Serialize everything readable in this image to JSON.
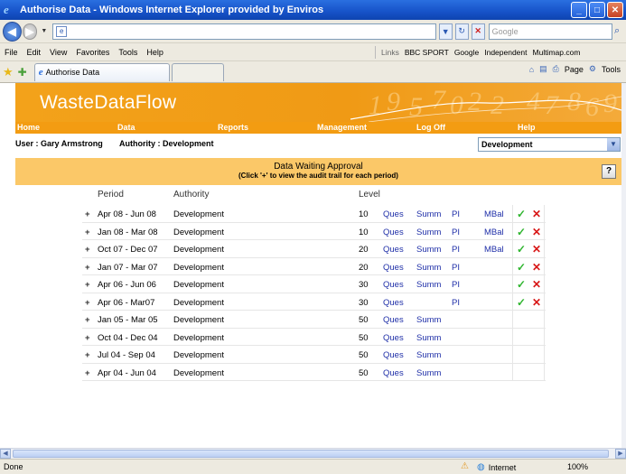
{
  "window": {
    "title": "Authorise Data - Windows Internet Explorer provided by Enviros",
    "min_glyph": "_",
    "max_glyph": "□",
    "close_glyph": "✕"
  },
  "address": {
    "url": "",
    "search_placeholder": "Google"
  },
  "menu": [
    "File",
    "Edit",
    "View",
    "Favorites",
    "Tools",
    "Help"
  ],
  "links": {
    "label": "Links",
    "items": [
      "BBC SPORT",
      "Google",
      "Independent",
      "Multimap.com"
    ]
  },
  "tab": {
    "active_label": "Authorise Data"
  },
  "commands": {
    "page": "Page",
    "tools": "Tools"
  },
  "site": {
    "logo": "WasteDataFlow",
    "nav": [
      "Home",
      "Data",
      "Reports",
      "Management",
      "Log Off",
      "Help"
    ],
    "user": "User : Gary Armstrong",
    "authority": "Authority : Development",
    "authority_selected": "Development"
  },
  "approval": {
    "title": "Data Waiting Approval",
    "subtitle": "(Click '+' to view the audit trail for each period)",
    "help_label": "?"
  },
  "table": {
    "headers": {
      "period": "Period",
      "authority": "Authority",
      "level": "Level"
    },
    "rows": [
      {
        "period": "Apr 08 - Jun 08",
        "authority": "Development",
        "level": "10",
        "ques": "Ques",
        "summ": "Summ",
        "pi": "PI",
        "mbal": "MBal",
        "approve": true
      },
      {
        "period": "Jan 08 - Mar 08",
        "authority": "Development",
        "level": "10",
        "ques": "Ques",
        "summ": "Summ",
        "pi": "PI",
        "mbal": "MBal",
        "approve": true
      },
      {
        "period": "Oct 07 - Dec 07",
        "authority": "Development",
        "level": "20",
        "ques": "Ques",
        "summ": "Summ",
        "pi": "PI",
        "mbal": "MBal",
        "approve": true
      },
      {
        "period": "Jan 07 - Mar 07",
        "authority": "Development",
        "level": "20",
        "ques": "Ques",
        "summ": "Summ",
        "pi": "PI",
        "mbal": "",
        "approve": true
      },
      {
        "period": "Apr 06 - Jun 06",
        "authority": "Development",
        "level": "30",
        "ques": "Ques",
        "summ": "Summ",
        "pi": "PI",
        "mbal": "",
        "approve": true
      },
      {
        "period": "Apr 06 - Mar07",
        "authority": "Development",
        "level": "30",
        "ques": "Ques",
        "summ": "",
        "pi": "PI",
        "mbal": "",
        "approve": true
      },
      {
        "period": "Jan 05 - Mar 05",
        "authority": "Development",
        "level": "50",
        "ques": "Ques",
        "summ": "Summ",
        "pi": "",
        "mbal": "",
        "approve": false
      },
      {
        "period": "Oct 04 - Dec 04",
        "authority": "Development",
        "level": "50",
        "ques": "Ques",
        "summ": "Summ",
        "pi": "",
        "mbal": "",
        "approve": false
      },
      {
        "period": "Jul 04 - Sep 04",
        "authority": "Development",
        "level": "50",
        "ques": "Ques",
        "summ": "Summ",
        "pi": "",
        "mbal": "",
        "approve": false
      },
      {
        "period": "Apr 04 - Jun 04",
        "authority": "Development",
        "level": "50",
        "ques": "Ques",
        "summ": "Summ",
        "pi": "",
        "mbal": "",
        "approve": false
      }
    ]
  },
  "status": {
    "left": "Done",
    "zone": "Internet",
    "zoom": "100%"
  },
  "colors": {
    "brand_orange": "#f39c12",
    "approval_header": "#fbc868",
    "link_blue": "#1f2fa8",
    "approve_green": "#2fb52f",
    "reject_red": "#d81818"
  }
}
